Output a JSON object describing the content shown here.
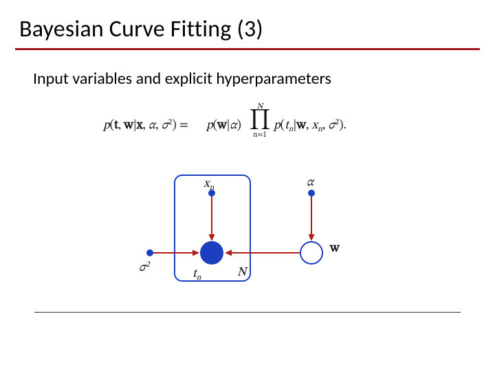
{
  "title": "Bayesian Curve Fitting (3)",
  "subtitle": "Input variables and explicit hyperparameters",
  "equation": {
    "lhs_p": "p",
    "lhs_open": "(",
    "lhs_t": "t",
    "lhs_comma1": ", ",
    "lhs_w": "w",
    "lhs_bar": "|",
    "lhs_x": "x",
    "lhs_comma2": ", ",
    "lhs_alpha": "α",
    "lhs_comma3": ", ",
    "lhs_sigma": "σ",
    "lhs_sq": "2",
    "lhs_close_eq": ") = ",
    "rhs1_p": "p",
    "rhs1_open": "(",
    "rhs1_w": "w",
    "rhs1_bar": "|",
    "rhs1_alpha": "α",
    "rhs1_close": ")",
    "prod_upper": "N",
    "prod_symbol": "∏",
    "prod_lower": "n=1",
    "rhs2_p": "p",
    "rhs2_open": "(",
    "rhs2_t": "t",
    "rhs2_tn": "n",
    "rhs2_bar": "|",
    "rhs2_w": "w",
    "rhs2_comma1": ", ",
    "rhs2_x": "x",
    "rhs2_xn": "n",
    "rhs2_comma2": ", ",
    "rhs2_sigma": "σ",
    "rhs2_sq": "2",
    "rhs2_close": ")."
  },
  "graph": {
    "xn_label_x": "x",
    "xn_label_n": "n",
    "tn_label_t": "t",
    "tn_label_n": "n",
    "alpha_label": "α",
    "w_label": "w",
    "sigma_label": "σ",
    "sigma_sq": "2",
    "plate_label": "N"
  }
}
